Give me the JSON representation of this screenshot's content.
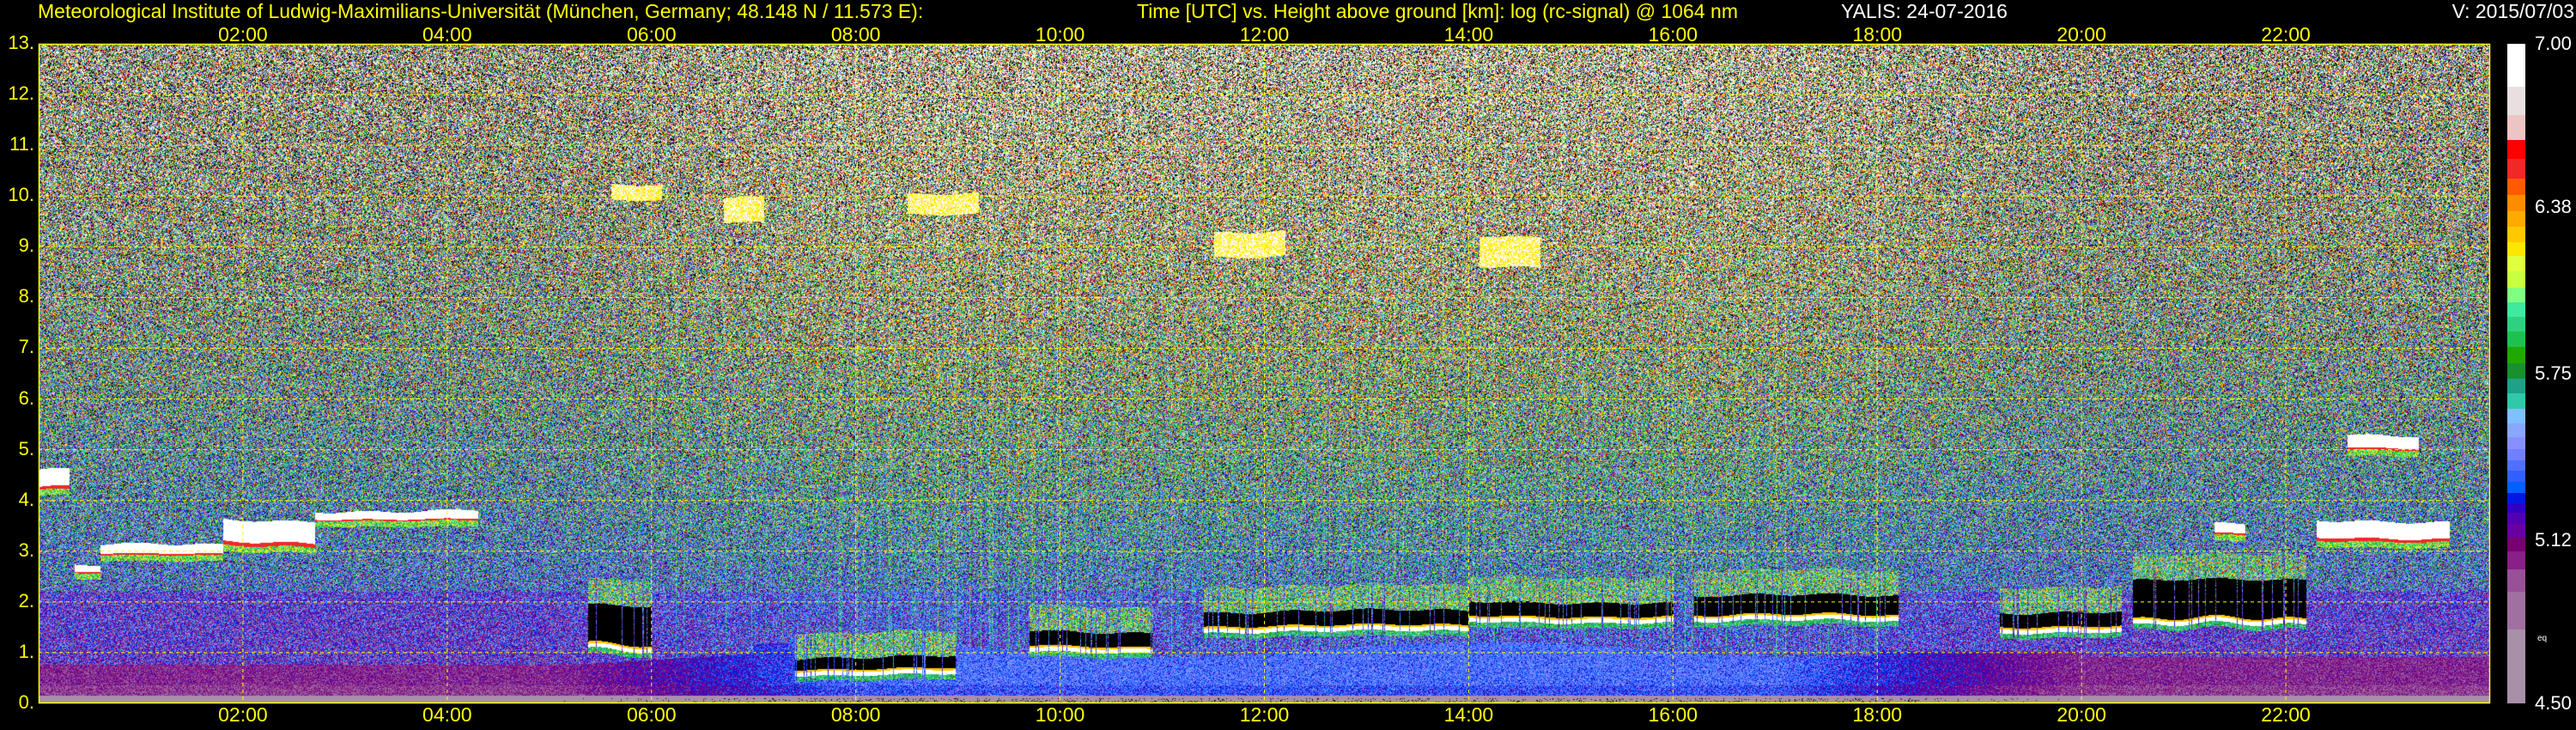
{
  "header": {
    "institute": "Meteorological Institute of Ludwig-Maximilians-Universität (München, Germany; 48.148 N / 11.573 E):",
    "description": "Time [UTC] vs. Height above ground [km]: log (rc-signal) @ 1064 nm",
    "station_date": "YALIS: 24-07-2016",
    "version": "V: 2015/07/03"
  },
  "chart_data": {
    "type": "heatmap",
    "title": "Time [UTC] vs. Height above ground [km]: log (rc-signal) @ 1064 nm",
    "xlabel": "Time [UTC]",
    "ylabel": "Height above ground [km]",
    "xlim": [
      0,
      24
    ],
    "ylim": [
      0,
      13
    ],
    "x_ticks": [
      {
        "value": 2,
        "label": "02:00"
      },
      {
        "value": 4,
        "label": "04:00"
      },
      {
        "value": 6,
        "label": "06:00"
      },
      {
        "value": 8,
        "label": "08:00"
      },
      {
        "value": 10,
        "label": "10:00"
      },
      {
        "value": 12,
        "label": "12:00"
      },
      {
        "value": 14,
        "label": "14:00"
      },
      {
        "value": 16,
        "label": "16:00"
      },
      {
        "value": 18,
        "label": "18:00"
      },
      {
        "value": 20,
        "label": "20:00"
      },
      {
        "value": 22,
        "label": "22:00"
      }
    ],
    "y_ticks": [
      {
        "value": 0,
        "label": "0."
      },
      {
        "value": 1,
        "label": "1."
      },
      {
        "value": 2,
        "label": "2."
      },
      {
        "value": 3,
        "label": "3."
      },
      {
        "value": 4,
        "label": "4."
      },
      {
        "value": 5,
        "label": "5."
      },
      {
        "value": 6,
        "label": "6."
      },
      {
        "value": 7,
        "label": "7."
      },
      {
        "value": 8,
        "label": "8."
      },
      {
        "value": 9,
        "label": "9."
      },
      {
        "value": 10,
        "label": "10."
      },
      {
        "value": 11,
        "label": "11."
      },
      {
        "value": 12,
        "label": "12."
      },
      {
        "value": 13,
        "label": "13."
      }
    ],
    "grid": true,
    "colorbar": {
      "range": [
        4.5,
        7.0
      ],
      "labels": [
        {
          "value": 7.0,
          "label": "7.00"
        },
        {
          "value": 6.38,
          "label": "6.38"
        },
        {
          "value": 5.75,
          "label": "5.75"
        },
        {
          "value": 5.12,
          "label": "5.12"
        },
        {
          "value": 4.5,
          "label": "4.50"
        }
      ],
      "extra_label": "eq",
      "colors_top_to_bottom": [
        "#ffffff",
        "#e8e0e0",
        "#ecc4c4",
        "#ff0000",
        "#f02828",
        "#ff5a00",
        "#ff8c00",
        "#ffaa00",
        "#ffc800",
        "#ffe600",
        "#e0ff40",
        "#c8ff40",
        "#80ff80",
        "#40e8a0",
        "#30d080",
        "#20c050",
        "#20a800",
        "#189030",
        "#20a088",
        "#30c8a8",
        "#80c0ff",
        "#88a8ff",
        "#8890ff",
        "#7080ff",
        "#5070ff",
        "#3060ff",
        "#0060ff",
        "#0018e0",
        "#3000c0",
        "#5000b0",
        "#6800a0",
        "#780070",
        "#882088",
        "#985098",
        "#a070a0",
        "#a890a8"
      ],
      "weights": [
        95,
        65,
        54,
        43,
        43,
        37,
        37,
        35,
        33,
        32,
        33,
        38,
        32,
        33,
        32,
        35,
        35,
        35,
        33,
        34,
        33,
        30,
        27,
        25,
        23,
        25,
        25,
        25,
        20,
        25,
        30,
        30,
        40,
        50,
        85,
        165
      ]
    },
    "features": [
      {
        "kind": "cloud-white",
        "t": [
          0.0,
          0.3
        ],
        "h": [
          4.2,
          4.6
        ]
      },
      {
        "kind": "cloud-white",
        "t": [
          0.6,
          1.8
        ],
        "h": [
          2.9,
          3.1
        ]
      },
      {
        "kind": "cloud-white",
        "t": [
          1.8,
          2.7
        ],
        "h": [
          3.1,
          3.6
        ]
      },
      {
        "kind": "cloud-white",
        "t": [
          2.7,
          4.3
        ],
        "h": [
          3.6,
          3.8
        ]
      },
      {
        "kind": "cloud-white",
        "t": [
          0.35,
          0.6
        ],
        "h": [
          2.55,
          2.7
        ]
      },
      {
        "kind": "cloud-low",
        "t": [
          5.35,
          6.0
        ],
        "h": [
          1.0,
          1.9
        ]
      },
      {
        "kind": "cloud-low",
        "t": [
          7.4,
          9.0
        ],
        "h": [
          0.55,
          0.9
        ]
      },
      {
        "kind": "cloud-low",
        "t": [
          9.7,
          10.9
        ],
        "h": [
          1.0,
          1.4
        ]
      },
      {
        "kind": "cloud-low",
        "t": [
          11.4,
          14.0
        ],
        "h": [
          1.4,
          1.8
        ]
      },
      {
        "kind": "cloud-low",
        "t": [
          14.0,
          16.0
        ],
        "h": [
          1.6,
          2.0
        ]
      },
      {
        "kind": "cloud-low",
        "t": [
          16.2,
          18.2
        ],
        "h": [
          1.6,
          2.1
        ]
      },
      {
        "kind": "cloud-low",
        "t": [
          19.2,
          20.4
        ],
        "h": [
          1.4,
          1.8
        ]
      },
      {
        "kind": "cloud-low",
        "t": [
          20.5,
          22.2
        ],
        "h": [
          1.5,
          2.4
        ]
      },
      {
        "kind": "cloud-white",
        "t": [
          21.3,
          21.6
        ],
        "h": [
          3.3,
          3.5
        ]
      },
      {
        "kind": "cloud-white",
        "t": [
          22.3,
          23.6
        ],
        "h": [
          3.2,
          3.6
        ]
      },
      {
        "kind": "cloud-white",
        "t": [
          22.6,
          23.3
        ],
        "h": [
          5.0,
          5.3
        ]
      },
      {
        "kind": "cirrus",
        "t": [
          5.6,
          6.1
        ],
        "h": [
          9.9,
          10.2
        ]
      },
      {
        "kind": "cirrus",
        "t": [
          6.7,
          7.1
        ],
        "h": [
          9.5,
          10.0
        ]
      },
      {
        "kind": "cirrus",
        "t": [
          8.5,
          9.2
        ],
        "h": [
          9.6,
          10.0
        ]
      },
      {
        "kind": "cirrus",
        "t": [
          11.5,
          12.2
        ],
        "h": [
          8.8,
          9.3
        ]
      },
      {
        "kind": "cirrus",
        "t": [
          14.1,
          14.7
        ],
        "h": [
          8.6,
          9.2
        ]
      }
    ]
  }
}
